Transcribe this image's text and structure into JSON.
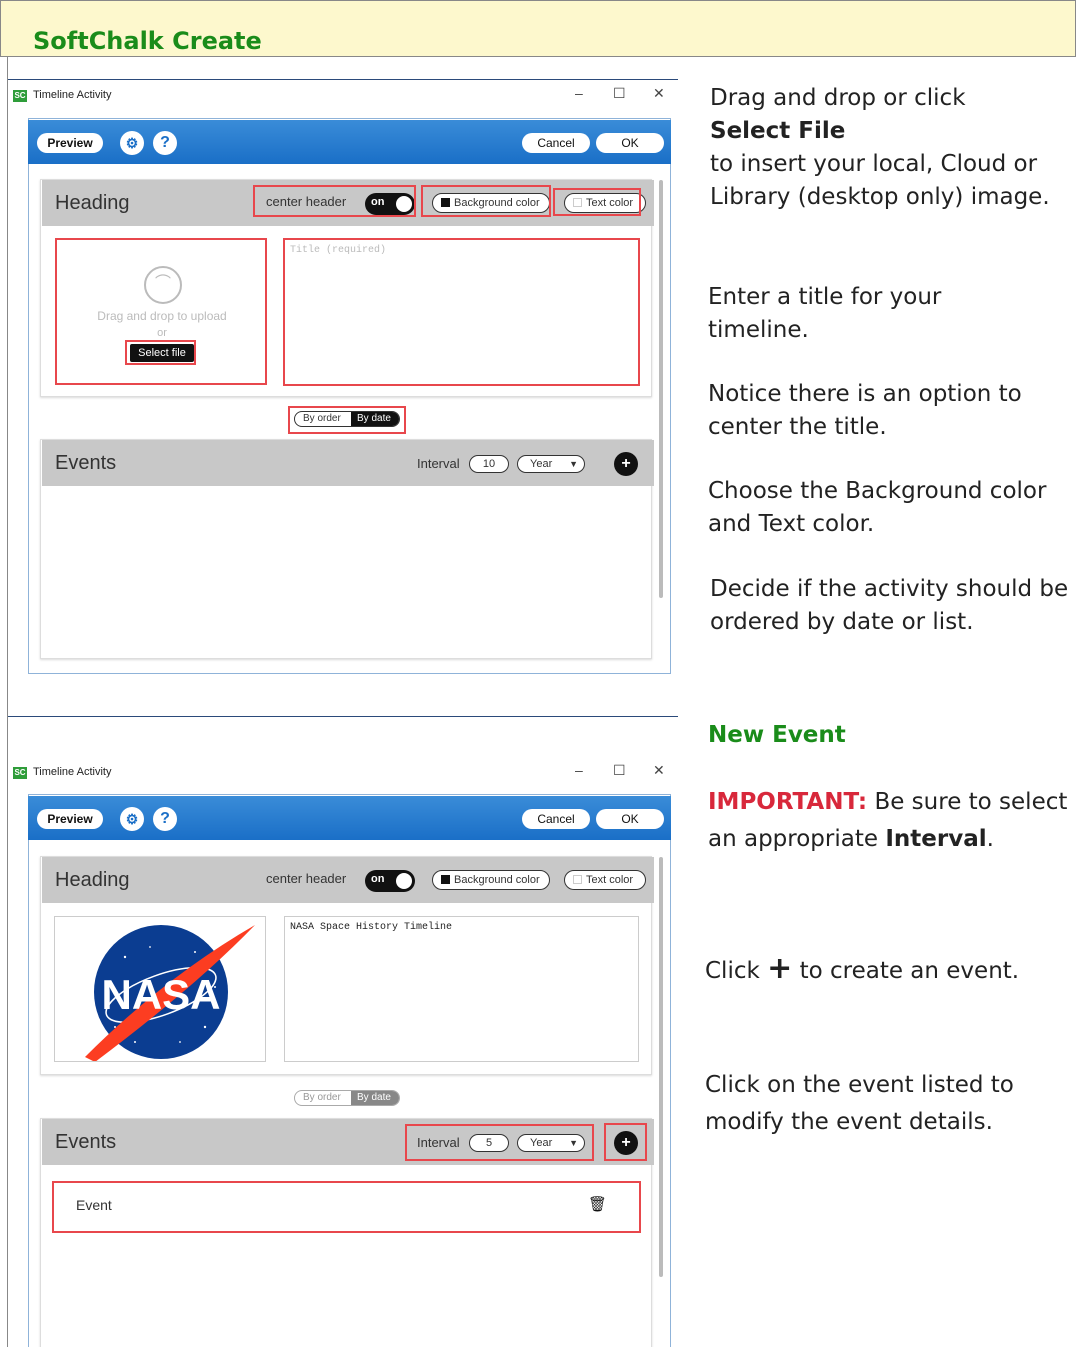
{
  "banner": {
    "title": "SoftChalk Create"
  },
  "window": {
    "title": "Timeline Activity",
    "controls": {
      "minimize": "–",
      "maximize": "☐",
      "close": "✕"
    },
    "logo": "SC"
  },
  "toolbar": {
    "preview": "Preview",
    "cancel": "Cancel",
    "ok": "OK",
    "settings_icon": "gear-icon",
    "help": "?"
  },
  "heading": {
    "label": "Heading",
    "center_header": "center header",
    "toggle": "on",
    "background_color": "Background color",
    "text_color": "Text color"
  },
  "upload": {
    "drag_text": "Drag and drop to upload",
    "or": "or",
    "select_file": "Select file"
  },
  "title_field": {
    "placeholder": "Title (required)",
    "value": "NASA Space History Timeline"
  },
  "order": {
    "by_order": "By order",
    "by_date": "By date"
  },
  "events": {
    "label": "Events",
    "interval_label": "Interval",
    "interval_value_1": "10",
    "interval_value_2": "5",
    "unit": "Year",
    "add": "+",
    "event_item": "Event"
  },
  "notes": {
    "n1_a": "Drag and drop or click",
    "n1_b": "Select File",
    "n1_c": "to insert your local, Cloud or Library (desktop only) image.",
    "n2": "Enter a title for your timeline.",
    "n3": "Notice there is an option to center the title.",
    "n4": "Choose the Background color and Text color.",
    "n5": "Decide if the activity should be ordered by date or list.",
    "new_event": "New Event",
    "important": "IMPORTANT:",
    "important_rest": "Be sure to select an appropriate",
    "interval_word": "Interval",
    "period": ".",
    "click": "Click",
    "plus": "+",
    "to_create": "to create an event.",
    "n7": "Click on the event listed to modify the event details."
  },
  "colors": {
    "green": "#1a8c1a",
    "red": "#d8283b",
    "toolbar_blue": "#1a6fc7",
    "highlight": "#e8474c"
  },
  "image": {
    "logo_text": "NASA"
  }
}
